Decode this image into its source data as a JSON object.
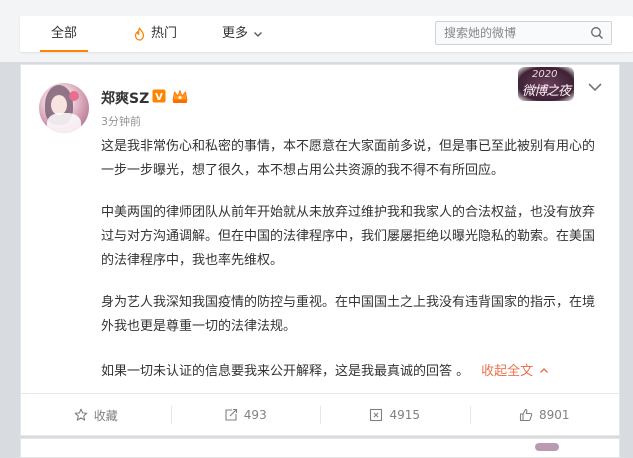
{
  "tabs": [
    {
      "label": "全部",
      "active": true
    },
    {
      "label": "热门",
      "icon": "flame-icon"
    },
    {
      "label": "更多",
      "icon": "chevron-down-icon"
    }
  ],
  "search": {
    "placeholder": "搜索她的微博"
  },
  "post": {
    "user_name": "郑爽SZ",
    "verified_badge": "V",
    "time": "3分钟前",
    "banner": {
      "year": "2020",
      "title": "微博之夜"
    },
    "paragraphs": [
      "这是我非常伤心和私密的事情，本不愿意在大家面前多说，但是事已至此被别有用心的一步一步曝光，想了很久，本不想占用公共资源的我不得不有所回应。",
      "中美两国的律师团队从前年开始就从未放弃过维护我和我家人的合法权益，也没有放弃过与对方沟通调解。但在中国的法律程序中，我们屡屡拒绝以曝光隐私的勒索。在美国的法律程序中，我也率先维权。",
      "身为艺人我深知我国疫情的防控与重视。在中国国土之上我没有违背国家的指示，在境外我也更是尊重一切的法律法规。",
      "如果一切未认证的信息要我来公开解释，这是我最真诚的回答 。"
    ],
    "collapse_label": "收起全文",
    "actions": [
      {
        "label": "收藏",
        "icon": "star-icon"
      },
      {
        "label": "493",
        "icon": "repost-icon"
      },
      {
        "label": "4915",
        "icon": "comment-icon"
      },
      {
        "label": "8901",
        "icon": "like-icon"
      }
    ]
  },
  "colors": {
    "accent": "#ff8200",
    "link": "#eb7350",
    "vip": "#ff8200",
    "verified": "#f5a623"
  }
}
